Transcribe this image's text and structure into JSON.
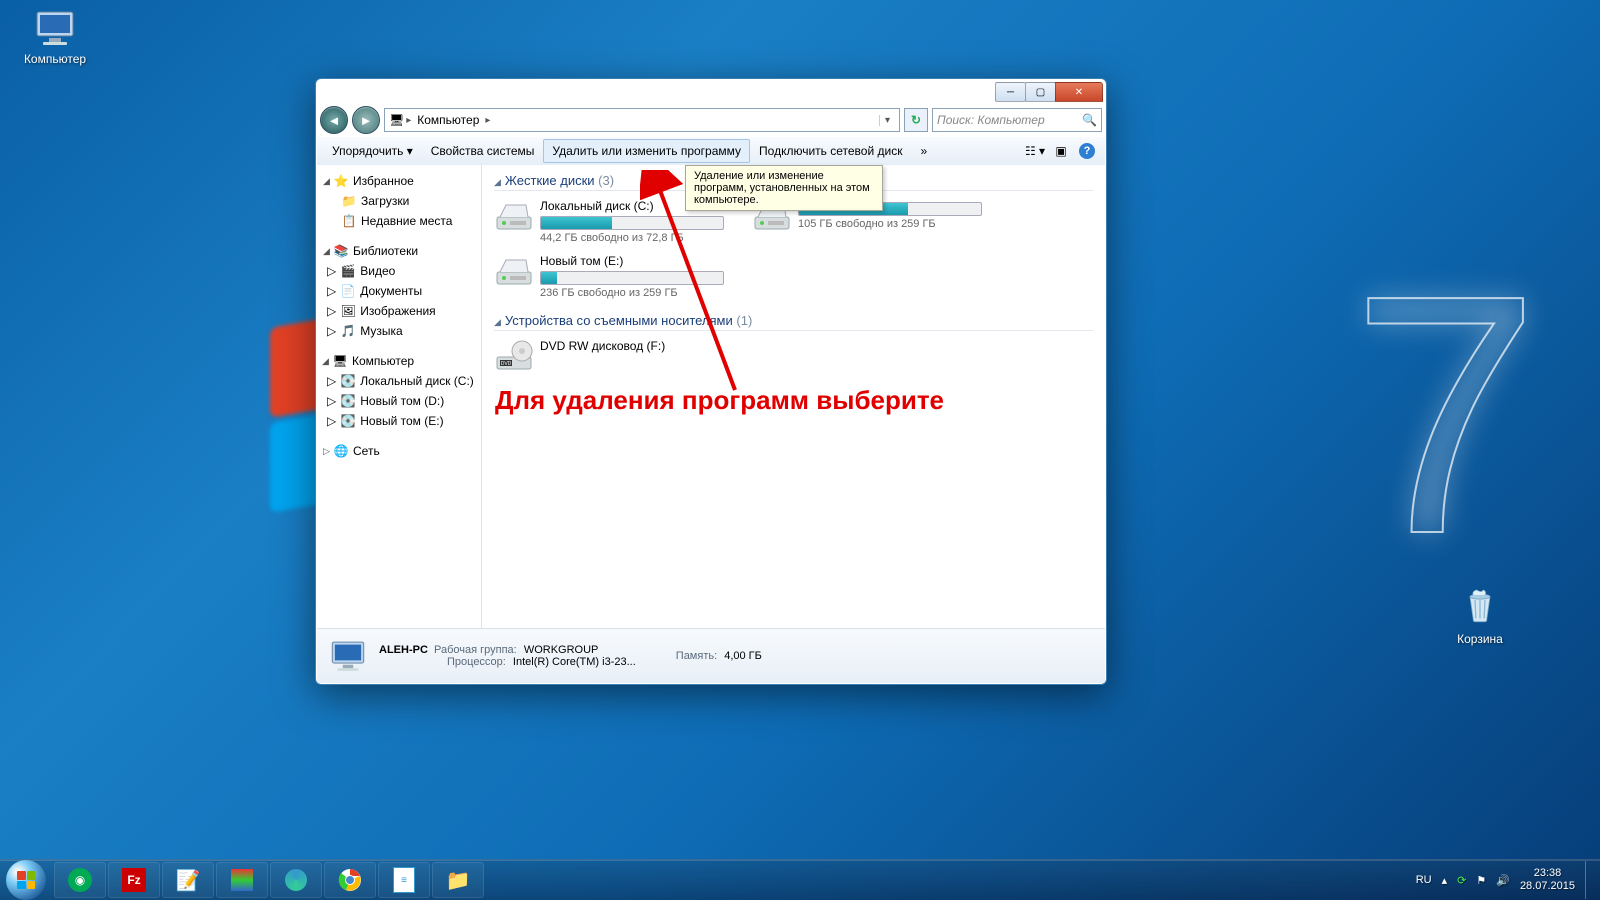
{
  "desktop": {
    "computer_label": "Компьютер",
    "trash_label": "Корзина"
  },
  "window": {
    "addressbar": {
      "root_icon": "computer-icon",
      "segment": "Компьютер"
    },
    "search_placeholder": "Поиск: Компьютер",
    "toolbar": {
      "organize": "Упорядочить ▾",
      "sysprops": "Свойства системы",
      "uninstall": "Удалить или изменить программу",
      "mapdrive": "Подключить сетевой диск",
      "overflow": "»"
    },
    "tooltip": "Удаление или изменение программ, установленных на этом компьютере.",
    "nav": {
      "favorites": "Избранное",
      "downloads": "Загрузки",
      "recent": "Недавние места",
      "libraries": "Библиотеки",
      "video": "Видео",
      "documents": "Документы",
      "pictures": "Изображения",
      "music": "Музыка",
      "computer": "Компьютер",
      "drive_c": "Локальный диск (C:)",
      "drive_d": "Новый том (D:)",
      "drive_e": "Новый том (E:)",
      "network": "Сеть"
    },
    "content": {
      "hdd_header": "Жесткие диски",
      "hdd_count": "(3)",
      "removable_header": "Устройства со съемными носителями",
      "removable_count": "(1)",
      "drives": {
        "c": {
          "name": "Локальный диск (C:)",
          "free": "44,2 ГБ свободно из 72,8 ГБ",
          "pct": 39
        },
        "d": {
          "name": "",
          "free": "105 ГБ свободно из 259 ГБ",
          "pct": 60
        },
        "e": {
          "name": "Новый том (E:)",
          "free": "236 ГБ свободно из 259 ГБ",
          "pct": 9
        }
      },
      "dvd": "DVD RW дисковод (F:)"
    },
    "details": {
      "pcname": "ALEH-PC",
      "workgroup_k": "Рабочая группа:",
      "workgroup_v": "WORKGROUP",
      "mem_k": "Память:",
      "mem_v": "4,00 ГБ",
      "cpu_k": "Процессор:",
      "cpu_v": "Intel(R) Core(TM) i3-23..."
    }
  },
  "annotation": "Для удаления программ выберите",
  "taskbar": {
    "lang": "RU",
    "time": "23:38",
    "date": "28.07.2015"
  }
}
